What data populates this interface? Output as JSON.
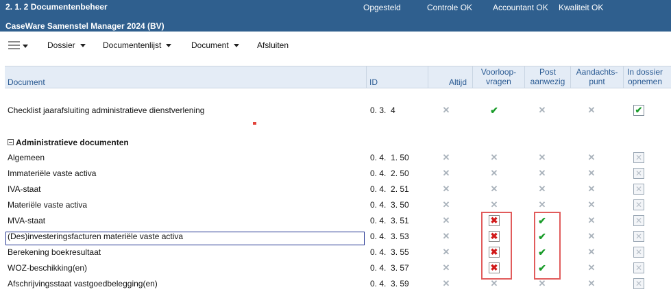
{
  "header": {
    "section_title": "2. 1.  2 Documentenbeheer",
    "engagement": "CaseWare Samenstel Manager 2024 (BV)",
    "status": [
      "Opgesteld",
      "Controle OK",
      "Accountant OK",
      "Kwaliteit OK"
    ]
  },
  "menubar": {
    "hamburger_icon": "hamburger-menu-icon",
    "items": [
      "Dossier",
      "Documentenlijst",
      "Document",
      "Afsluiten"
    ]
  },
  "table": {
    "columns": {
      "document": "Document",
      "id": "ID",
      "altijd": "Altijd",
      "voorloop": [
        "Voorloop-",
        "vragen"
      ],
      "post": [
        "Post",
        "aanwezig"
      ],
      "aandacht": [
        "Aandachts-",
        "punt"
      ],
      "dossier": [
        "In dossier",
        "opnemen"
      ]
    },
    "top_row": {
      "document": "Checklist jaarafsluiting administratieve dienstverlening",
      "id": "0. 3.  4",
      "altijd": "x-grey",
      "voorloop": "check-green",
      "post": "x-grey",
      "aandacht": "x-grey",
      "dossier": "checkbox-checked"
    },
    "group_label": "Administratieve documenten",
    "rows": [
      {
        "document": "Algemeen",
        "id": "0. 4.  1. 50",
        "altijd": "x-grey",
        "voorloop": "x-grey",
        "post": "x-grey",
        "aandacht": "x-grey",
        "dossier": "checkbox-disabled-x"
      },
      {
        "document": "Immateriële vaste activa",
        "id": "0. 4.  2. 50",
        "altijd": "x-grey",
        "voorloop": "x-grey",
        "post": "x-grey",
        "aandacht": "x-grey",
        "dossier": "checkbox-disabled-x"
      },
      {
        "document": "IVA-staat",
        "id": "0. 4.  2. 51",
        "altijd": "x-grey",
        "voorloop": "x-grey",
        "post": "x-grey",
        "aandacht": "x-grey",
        "dossier": "checkbox-disabled-x"
      },
      {
        "document": "Materiële vaste activa",
        "id": "0. 4.  3. 50",
        "altijd": "x-grey",
        "voorloop": "x-grey",
        "post": "x-grey",
        "aandacht": "x-grey",
        "dossier": "checkbox-disabled-x"
      },
      {
        "document": "MVA-staat",
        "id": "0. 4.  3. 51",
        "altijd": "x-grey",
        "voorloop": "x-red-box",
        "post": "check-green",
        "aandacht": "x-grey",
        "dossier": "checkbox-disabled-x"
      },
      {
        "document": "(Des)investeringsfacturen materiële vaste activa",
        "id": "0. 4.  3. 53",
        "altijd": "x-grey",
        "voorloop": "x-red-box",
        "post": "check-green",
        "aandacht": "x-grey",
        "dossier": "checkbox-disabled-x"
      },
      {
        "document": "Berekening boekresultaat",
        "id": "0. 4.  3. 55",
        "altijd": "x-grey",
        "voorloop": "x-red-box",
        "post": "check-green",
        "aandacht": "x-grey",
        "dossier": "checkbox-disabled-x"
      },
      {
        "document": "WOZ-beschikking(en)",
        "id": "0. 4.  3. 57",
        "altijd": "x-grey",
        "voorloop": "x-red-box",
        "post": "check-green",
        "aandacht": "x-grey",
        "dossier": "checkbox-disabled-x"
      },
      {
        "document": "Afschrijvingsstaat vastgoedbelegging(en)",
        "id": "0. 4.  3. 59",
        "altijd": "x-grey",
        "voorloop": "x-grey",
        "post": "x-grey",
        "aandacht": "x-grey",
        "dossier": "checkbox-disabled-x"
      }
    ]
  },
  "colors": {
    "header_bg": "#2f5f8e",
    "column_header_text": "#2b5b93",
    "check_green": "#1a9c2a",
    "error_red": "#d11a1a",
    "highlight_box": "#e15b5b",
    "selection_outline": "#1c2e8f"
  }
}
